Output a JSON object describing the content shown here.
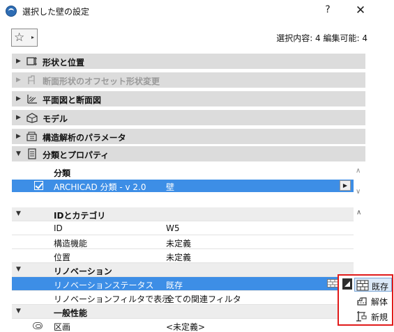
{
  "window": {
    "title": "選択した壁の設定",
    "help": "?",
    "close": "✕"
  },
  "toolbar": {
    "favorites_star": "☆",
    "favorites_arrow": "▸",
    "selection_info": "選択内容: 4 編集可能: 4"
  },
  "sections": [
    {
      "label": "形状と位置",
      "icon": "wall-geometry-icon",
      "expanded": false,
      "disabled": false
    },
    {
      "label": "断面形状のオフセット形状変更",
      "icon": "profile-offset-icon",
      "expanded": false,
      "disabled": true
    },
    {
      "label": "平面図と断面図",
      "icon": "floor-plan-section-icon",
      "expanded": false,
      "disabled": false
    },
    {
      "label": "モデル",
      "icon": "model-icon",
      "expanded": false,
      "disabled": false
    },
    {
      "label": "構造解析のパラメータ",
      "icon": "structural-analysis-icon",
      "expanded": false,
      "disabled": false
    },
    {
      "label": "分類とプロパティ",
      "icon": "classification-properties-icon",
      "expanded": true,
      "disabled": false
    }
  ],
  "classification": {
    "header": "分類",
    "row": {
      "checked": true,
      "name": "ARCHICAD 分類 - v 2.0",
      "value": "壁"
    }
  },
  "properties": {
    "groups": [
      {
        "label": "IDとカテゴリ",
        "rows": [
          {
            "name": "ID",
            "value": "W5"
          },
          {
            "name": "構造機能",
            "value": "未定義"
          },
          {
            "name": "位置",
            "value": "未定義"
          }
        ]
      },
      {
        "label": "リノベーション",
        "rows": [
          {
            "name": "リノベーションステータス",
            "value": "既存",
            "selected": true
          },
          {
            "name": "リノベーションフィルタで表示",
            "value": "全ての関連フィルタ"
          }
        ]
      },
      {
        "label": "一般性能",
        "rows": [
          {
            "name": "区画",
            "value": "<未定義>"
          }
        ]
      }
    ]
  },
  "renovation_popup": {
    "items": [
      {
        "label": "既存",
        "icon": "existing-brick-icon",
        "highlighted": true
      },
      {
        "label": "解体",
        "icon": "demolish-icon",
        "highlighted": false
      },
      {
        "label": "新規",
        "icon": "new-construction-icon",
        "highlighted": false
      }
    ]
  },
  "colors": {
    "selection": "#3d8ee6",
    "section_bg": "#dcdcdc",
    "popup_border": "#e11a1a"
  }
}
